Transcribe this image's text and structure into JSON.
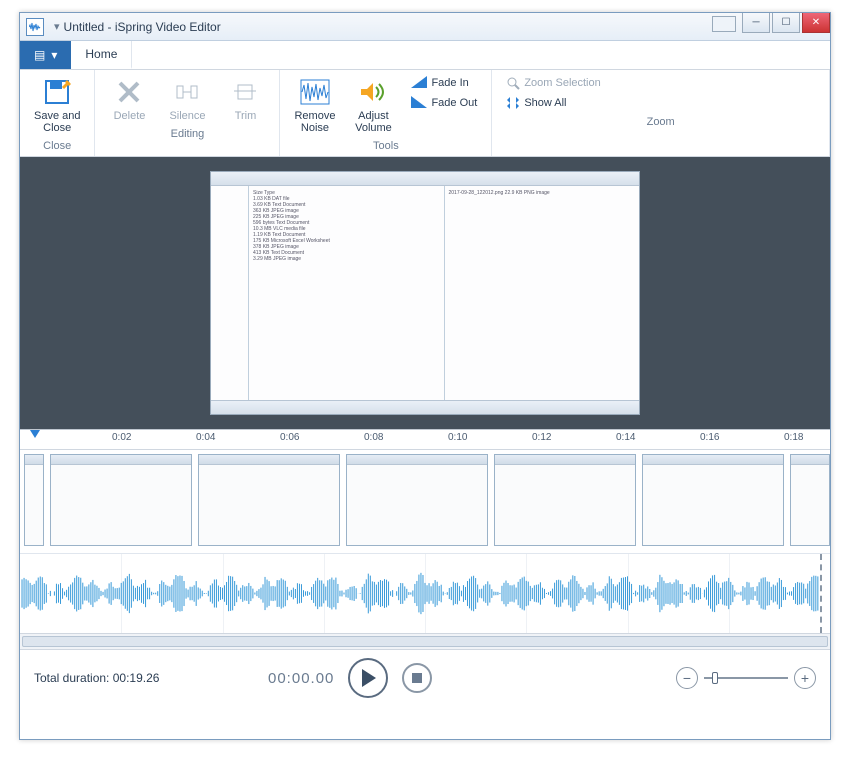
{
  "window": {
    "title": "Untitled - iSpring Video Editor"
  },
  "tabs": {
    "file_icon": "≡",
    "home": "Home"
  },
  "ribbon": {
    "close": {
      "save_and_close": "Save and\nClose",
      "label": "Close"
    },
    "editing": {
      "delete": "Delete",
      "silence": "Silence",
      "trim": "Trim",
      "label": "Editing"
    },
    "tools": {
      "remove_noise": "Remove\nNoise",
      "adjust_volume": "Adjust\nVolume",
      "fade_in": "Fade In",
      "fade_out": "Fade Out",
      "label": "Tools"
    },
    "zoom": {
      "zoom_selection": "Zoom Selection",
      "show_all": "Show All",
      "label": "Zoom"
    }
  },
  "ruler": {
    "ticks": [
      "0:02",
      "0:04",
      "0:06",
      "0:08",
      "0:10",
      "0:12",
      "0:14",
      "0:16",
      "0:18"
    ]
  },
  "playback": {
    "current_time": "00:00.00"
  },
  "status": {
    "total_duration_label": "Total duration: ",
    "total_duration": "00:19.26"
  }
}
